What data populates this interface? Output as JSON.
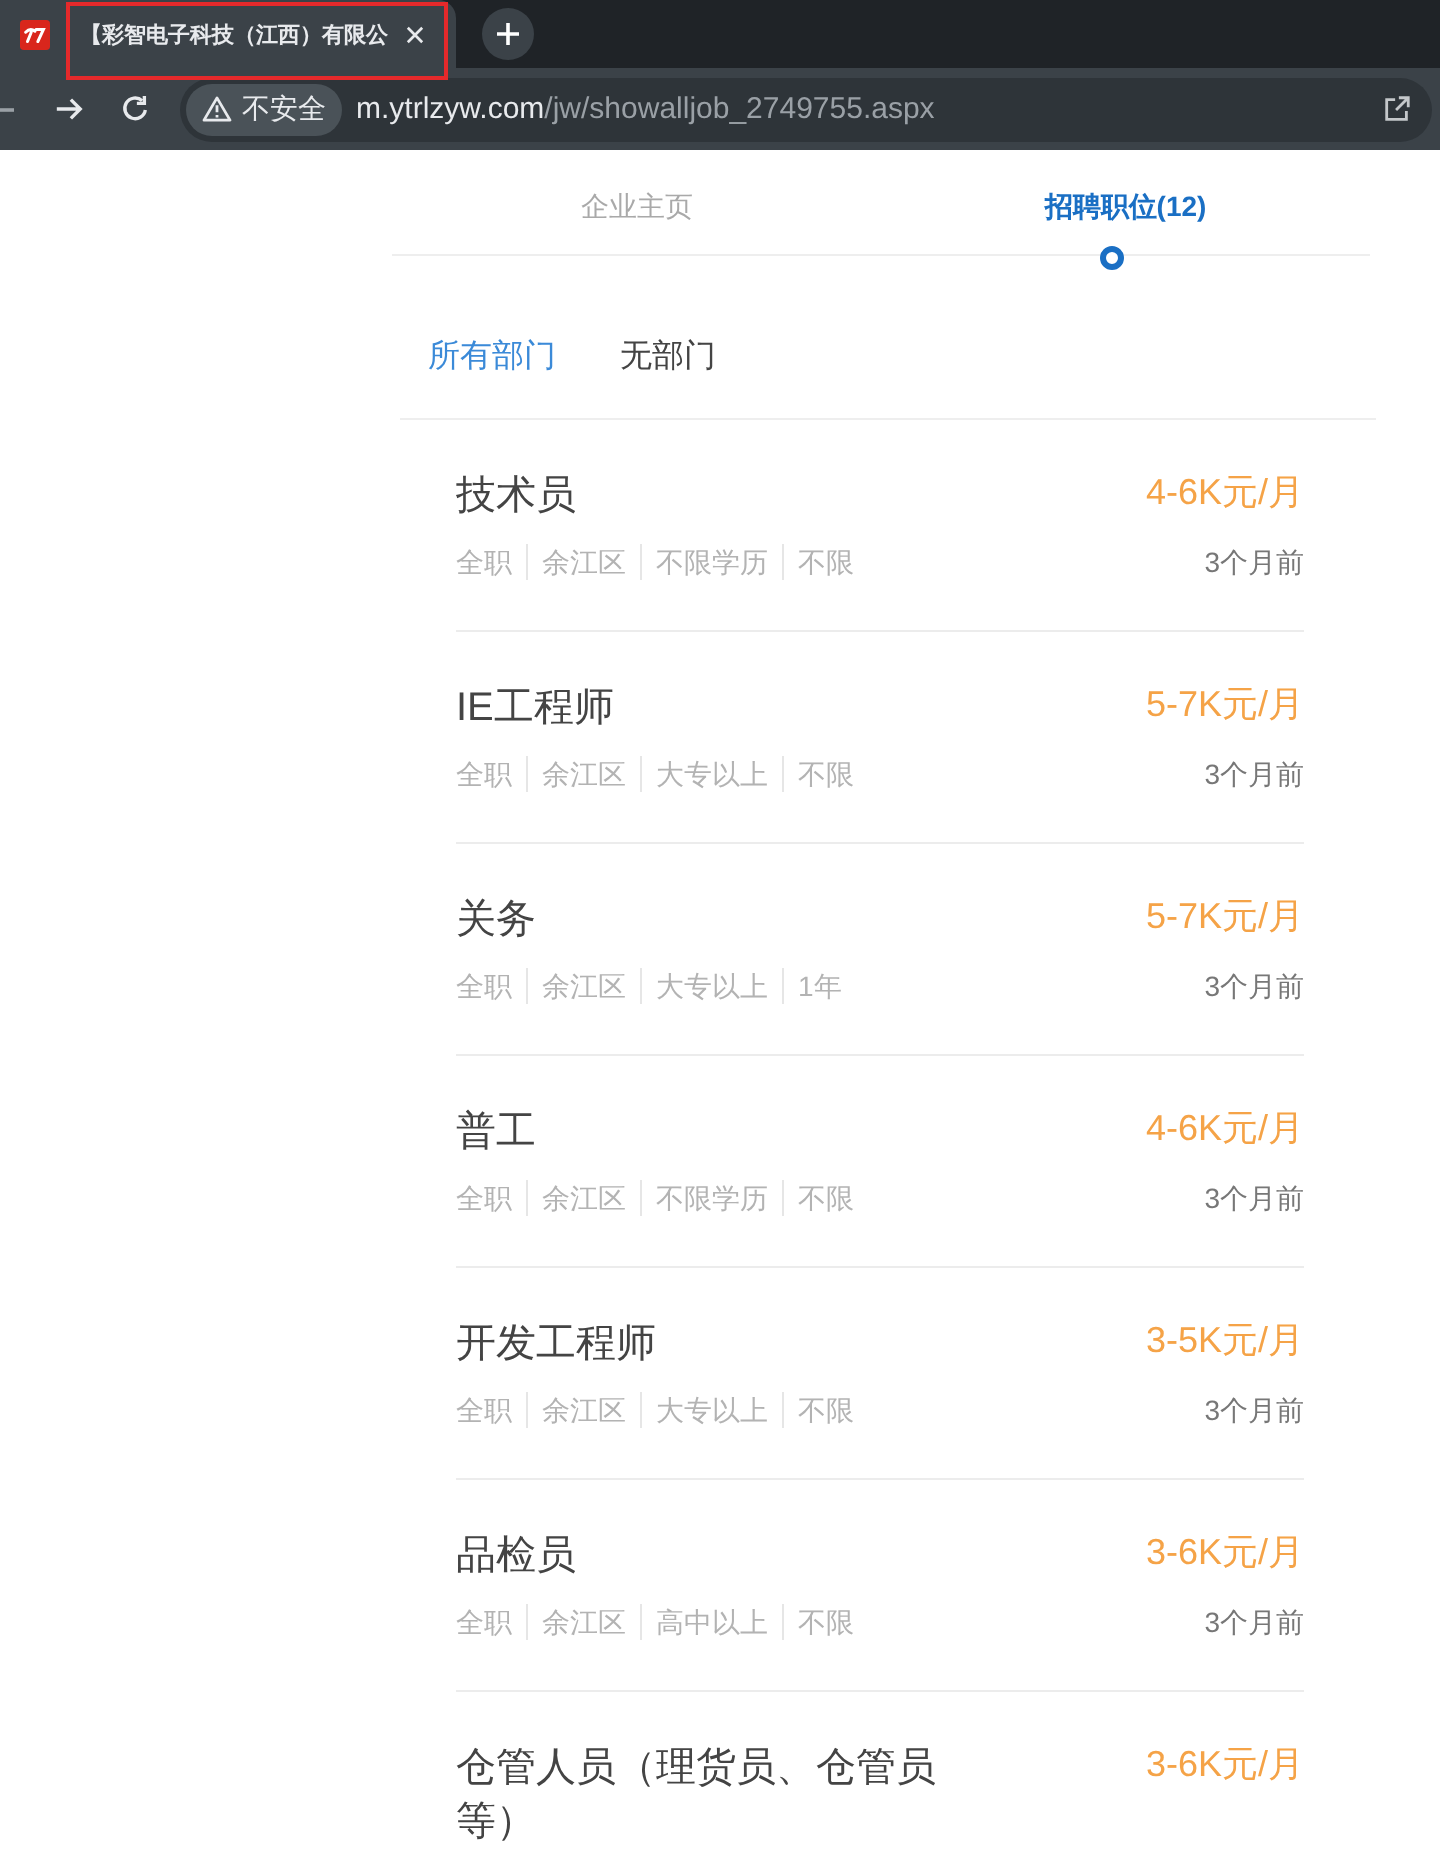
{
  "browser": {
    "tab": {
      "title": "【彩智电子科技（江西）有限公",
      "selected": true,
      "highlighted": true
    },
    "address_bar": {
      "security_label": "不安全",
      "host": "m.ytrlzyw.com",
      "path": "/jw/showalljob_2749755.aspx"
    }
  },
  "page_tabs": [
    {
      "label": "企业主页",
      "selected": false
    },
    {
      "label": "招聘职位(12)",
      "selected": true
    }
  ],
  "departments": [
    {
      "label": "所有部门",
      "selected": true
    },
    {
      "label": "无部门",
      "selected": false
    }
  ],
  "jobs": [
    {
      "title": "技术员",
      "salary": "4-6K元/月",
      "tags": [
        "全职",
        "余江区",
        "不限学历",
        "不限"
      ],
      "posted": "3个月前"
    },
    {
      "title": "IE工程师",
      "salary": "5-7K元/月",
      "tags": [
        "全职",
        "余江区",
        "大专以上",
        "不限"
      ],
      "posted": "3个月前"
    },
    {
      "title": "关务",
      "salary": "5-7K元/月",
      "tags": [
        "全职",
        "余江区",
        "大专以上",
        "1年"
      ],
      "posted": "3个月前"
    },
    {
      "title": "普工",
      "salary": "4-6K元/月",
      "tags": [
        "全职",
        "余江区",
        "不限学历",
        "不限"
      ],
      "posted": "3个月前"
    },
    {
      "title": "开发工程师",
      "salary": "3-5K元/月",
      "tags": [
        "全职",
        "余江区",
        "大专以上",
        "不限"
      ],
      "posted": "3个月前"
    },
    {
      "title": "品检员",
      "salary": "3-6K元/月",
      "tags": [
        "全职",
        "余江区",
        "高中以上",
        "不限"
      ],
      "posted": "3个月前"
    },
    {
      "title": "仓管人员（理货员、仓管员等）",
      "salary": "3-6K元/月"
    }
  ]
}
